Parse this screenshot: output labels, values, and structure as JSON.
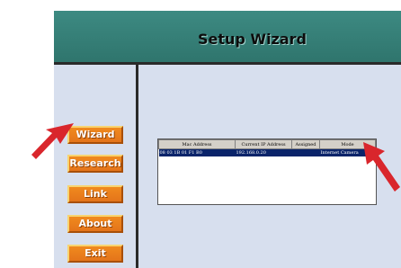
{
  "header": {
    "title": "Setup Wizard"
  },
  "nav": {
    "items": [
      {
        "label": "Wizard"
      },
      {
        "label": "Research"
      },
      {
        "label": "Link"
      },
      {
        "label": "About"
      },
      {
        "label": "Exit"
      }
    ]
  },
  "device_table": {
    "columns": [
      "Mac Address",
      "Current IP Address",
      "Assigned",
      "Mode"
    ],
    "rows": [
      {
        "mac": "08 03 1B 01 F1 B0",
        "ip": "192.168.0.20",
        "assigned": "",
        "mode": "Internet Camera"
      }
    ]
  },
  "colors": {
    "header_bg": "#2f756d",
    "panel_bg": "#d7dfee",
    "button_bg": "#e4741a",
    "selection_bg": "#0a246a",
    "arrow": "#d9262c"
  },
  "icons": {
    "pointer_arrow": "red-arrow-icon"
  }
}
